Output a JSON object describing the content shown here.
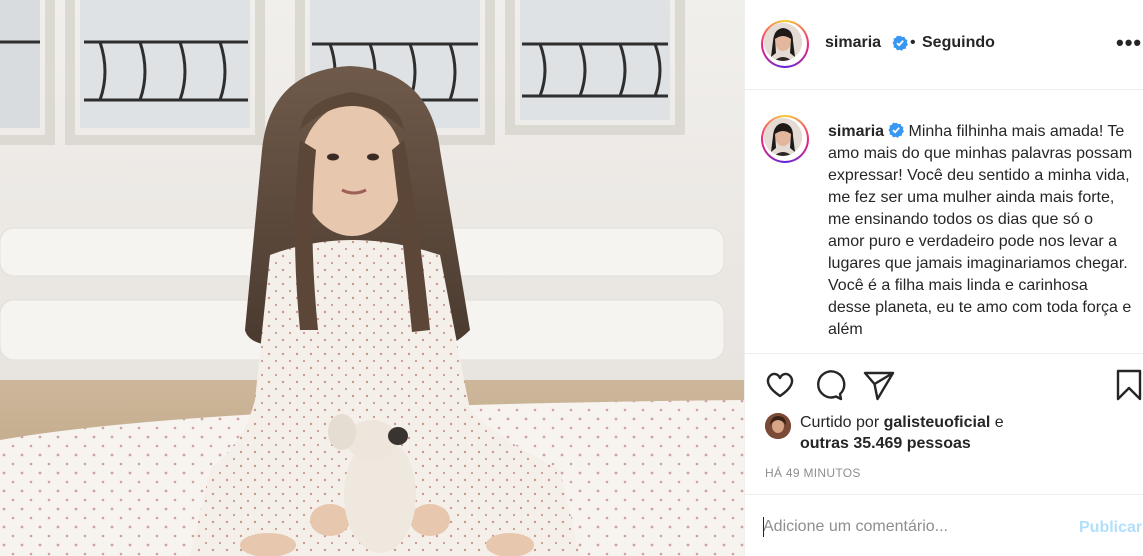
{
  "post": {
    "username": "simaria",
    "verified": true,
    "follow_status": "Seguindo",
    "separator": "•",
    "more_label": "•••"
  },
  "caption": {
    "username": "simaria",
    "text": "Minha filhinha mais amada! Te amo mais do que minhas palavras possam expressar! Você deu sentido a minha vida, me fez ser uma mulher ainda mais forte, me ensinando todos os dias que só o amor puro e verdadeiro pode nos levar a lugares que jamais imaginariamos chegar. Você é a filha mais linda e carinhosa desse planeta, eu te amo com toda força e além"
  },
  "actions": {
    "like_icon": "heart-icon",
    "comment_icon": "comment-icon",
    "share_icon": "paper-plane-icon",
    "save_icon": "bookmark-icon"
  },
  "likes": {
    "prefix": "Curtido por",
    "liker": "galisteuoficial",
    "joiner": "e",
    "others": "outras 35.469 pessoas"
  },
  "timestamp": "HÁ 49 MINUTOS",
  "comment_box": {
    "placeholder": "Adicione um comentário...",
    "value": "",
    "publish_label": "Publicar"
  },
  "colors": {
    "text": "#262626",
    "muted": "#8e8e8e",
    "verified": "#3897f0",
    "publish_disabled": "#b2dffc",
    "border": "#efefef"
  }
}
